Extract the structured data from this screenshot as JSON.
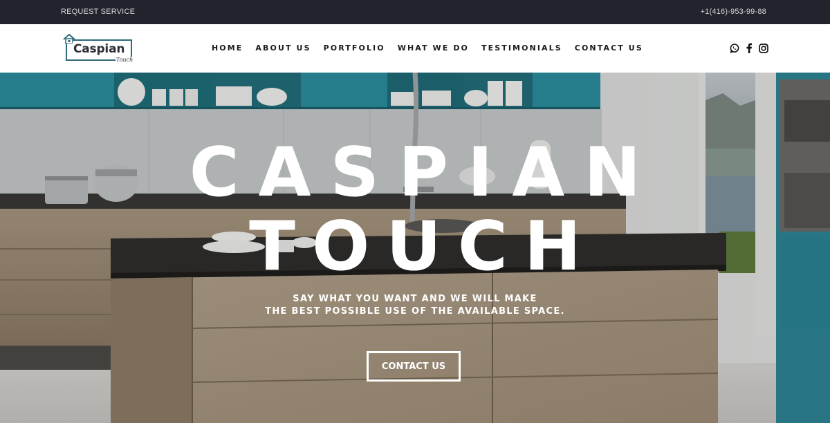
{
  "topbar": {
    "request_service": "REQUEST SERVICE",
    "phone": "+1(416)-953-99-88"
  },
  "logo": {
    "brand": "Caspian",
    "subtitle": "Touch"
  },
  "nav": {
    "items": [
      {
        "label": "HOME"
      },
      {
        "label": "ABOUT US"
      },
      {
        "label": "PORTFOLIO"
      },
      {
        "label": "WHAT WE DO"
      },
      {
        "label": "TESTIMONIALS"
      },
      {
        "label": "CONTACT US"
      }
    ]
  },
  "social": {
    "icons": [
      "whatsapp-icon",
      "facebook-icon",
      "instagram-icon"
    ]
  },
  "hero": {
    "title_line1": "CASPIAN",
    "title_line2": "TOUCH",
    "subtitle_line1": "SAY WHAT YOU WANT AND WE WILL MAKE",
    "subtitle_line2": "THE BEST POSSIBLE USE OF THE AVAILABLE SPACE.",
    "cta_label": "CONTACT US"
  },
  "colors": {
    "topbar_bg": "#22242d",
    "logo_accent": "#2e6a78",
    "cabinet_teal": "#2b8fa0"
  }
}
